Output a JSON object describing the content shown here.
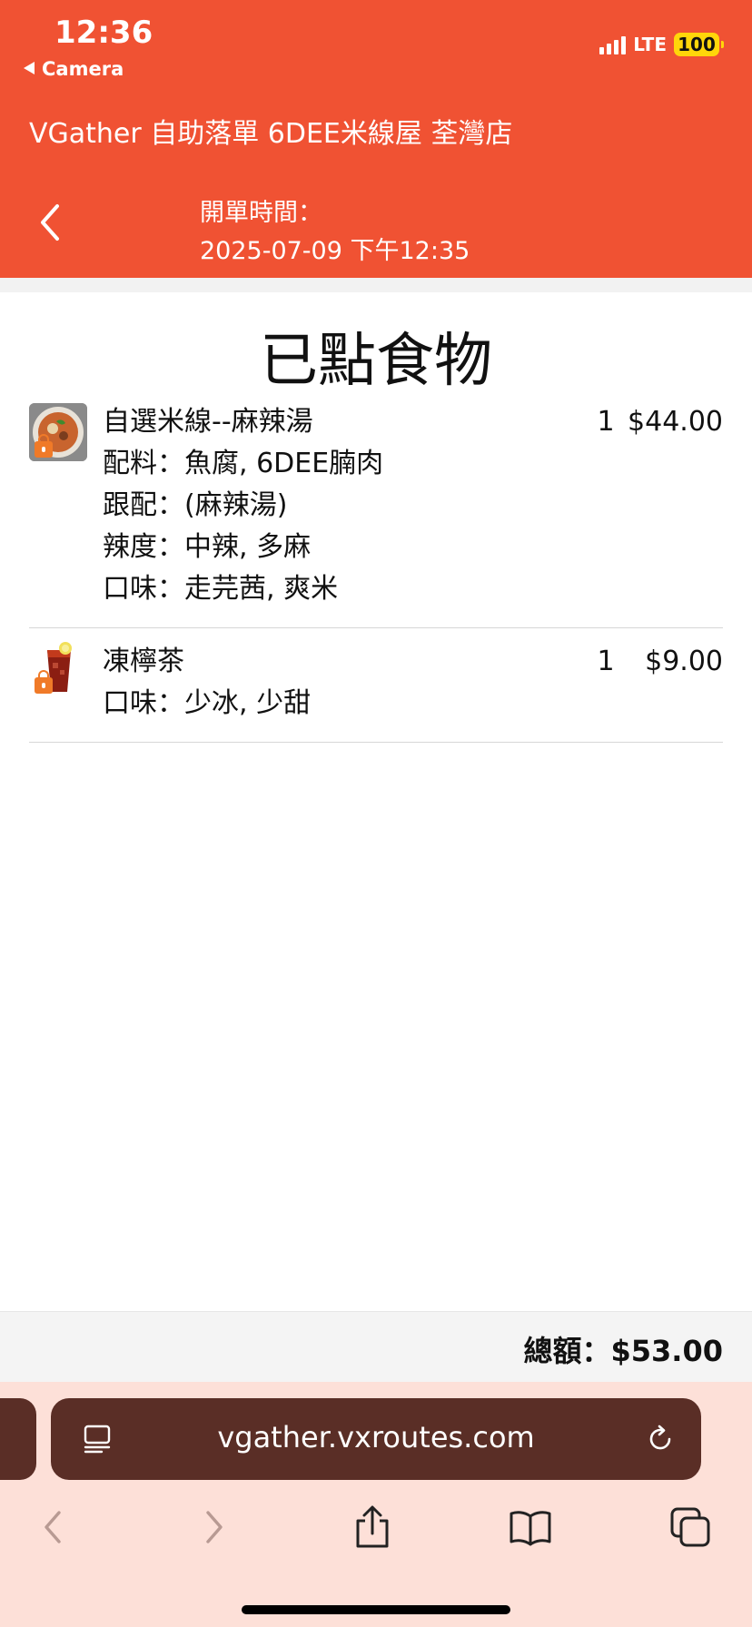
{
  "status_bar": {
    "time": "12:36",
    "back_app": "Camera",
    "network": "LTE",
    "battery": "100"
  },
  "header": {
    "app_title": "VGather 自助落單 6DEE米線屋 荃灣店",
    "open_time_label": "開單時間：",
    "open_time_value": "2025-07-09 下午12:35"
  },
  "main": {
    "title": "已點食物",
    "items": [
      {
        "name": "自選米線--麻辣湯",
        "details": [
          "配料：魚腐, 6DEE腩肉",
          "跟配：(麻辣湯)",
          "辣度：中辣, 多麻",
          "口味：走芫茜, 爽米"
        ],
        "qty": "1",
        "price": "$44.00",
        "icon": "noodle-soup-thumbnail"
      },
      {
        "name": "凍檸茶",
        "details": [
          "口味：少冰, 少甜"
        ],
        "qty": "1",
        "price": "$9.00",
        "icon": "iced-lemon-tea-thumbnail"
      }
    ]
  },
  "footer": {
    "total": "總額：$53.00"
  },
  "browser": {
    "url": "vgather.vxroutes.com",
    "accent": "#5a2e26",
    "background": "#fde0d8"
  },
  "colors": {
    "header": "#f05233",
    "lock_badge": "#f07a28",
    "battery": "#ffd60a"
  }
}
